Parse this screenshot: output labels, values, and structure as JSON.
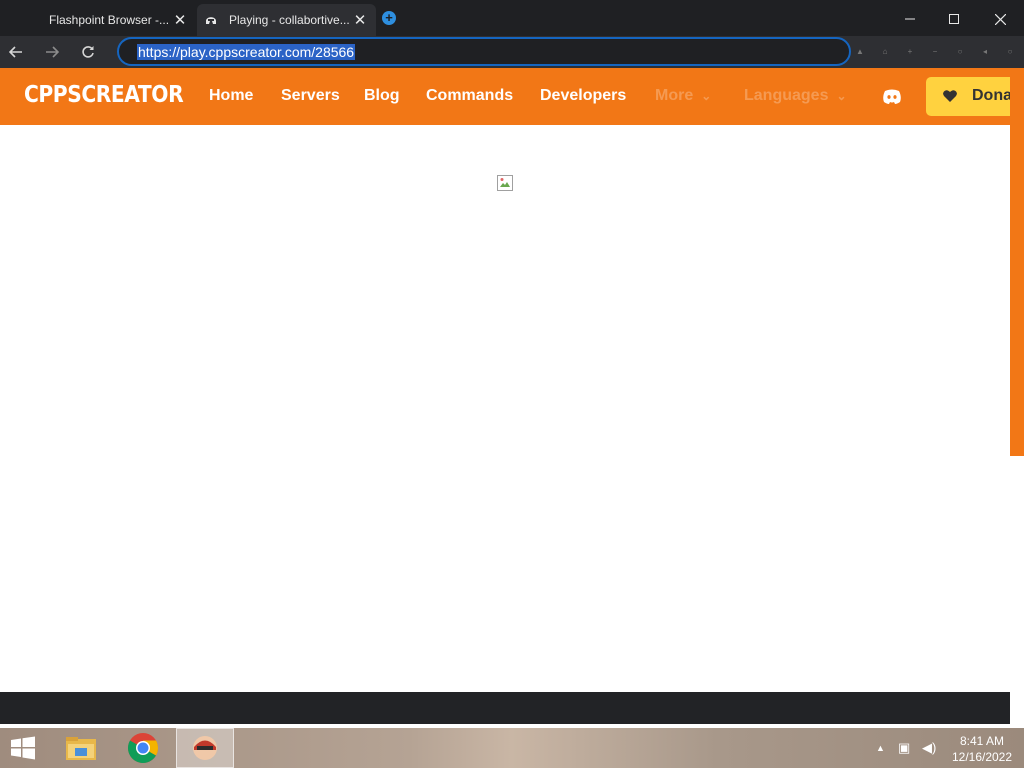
{
  "browser": {
    "tabs": [
      {
        "title": "Flashpoint Browser -...",
        "active": false
      },
      {
        "title": "Playing - collabortive...",
        "active": true
      }
    ],
    "new_tab_symbol": "+",
    "url": "https://play.cppscreator.com/28566",
    "window_controls": [
      "minimize",
      "maximize",
      "close"
    ]
  },
  "site": {
    "logo": "CPPSCREATOR",
    "nav": {
      "home": "Home",
      "servers": "Servers",
      "blog": "Blog",
      "commands": "Commands",
      "developers": "Developers",
      "more": "More",
      "languages": "Languages"
    },
    "donate_label": "Donate",
    "colors": {
      "brand": "#f27716",
      "donate": "#ffd23f",
      "muted_nav": "#f59a52"
    }
  },
  "taskbar": {
    "time": "8:41 AM",
    "date": "12/16/2022",
    "apps": [
      "file-explorer",
      "chrome",
      "flashpoint"
    ]
  },
  "icons": [
    "close-icon",
    "helmet-icon",
    "new-tab-icon",
    "back-arrow-icon",
    "forward-arrow-icon",
    "reload-icon",
    "chevron-down-icon",
    "discord-icon",
    "heart-icon",
    "broken-image-icon",
    "windows-logo-icon",
    "folder-icon",
    "chrome-icon",
    "flashpoint-icon",
    "wifi-icon",
    "speaker-icon",
    "tray-arrow-icon"
  ]
}
